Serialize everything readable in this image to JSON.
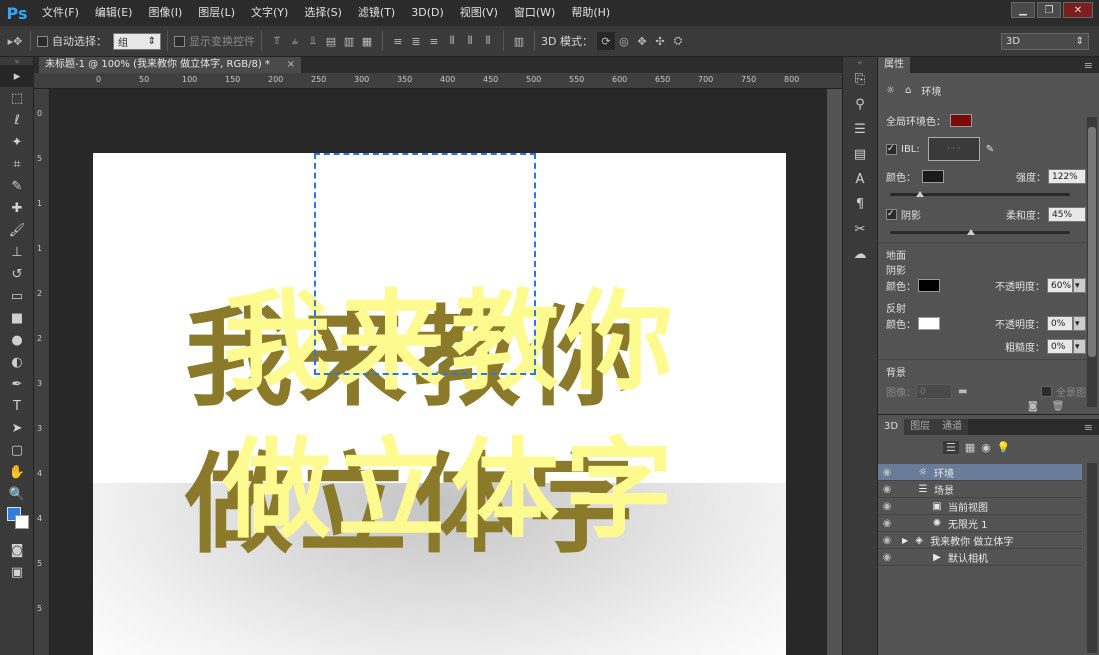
{
  "app": {
    "logo": "Ps"
  },
  "menu": [
    "文件(F)",
    "编辑(E)",
    "图像(I)",
    "图层(L)",
    "文字(Y)",
    "选择(S)",
    "滤镜(T)",
    "3D(D)",
    "视图(V)",
    "窗口(W)",
    "帮助(H)"
  ],
  "window_controls": {
    "minimize": "▁",
    "restore": "❐",
    "close": "✕"
  },
  "options": {
    "auto_select_label": "自动选择：",
    "auto_select_value": "组",
    "show_transform_label": "显示变换控件",
    "mode_3d_label": "3D 模式：",
    "workspace_value": "3D"
  },
  "document": {
    "tab_title": "未标题-1 @ 100% (我来教你 做立体字, RGB/8) *",
    "close": "×",
    "line1": "我来教你",
    "line2": "做立体字"
  },
  "ruler": {
    "top_ticks": [
      "0",
      "50",
      "100",
      "150",
      "200",
      "250",
      "300",
      "350",
      "400",
      "450",
      "500",
      "550",
      "600",
      "650",
      "700",
      "750",
      "800"
    ],
    "left_ticks": [
      "0",
      "5",
      "1",
      "1",
      "2",
      "2",
      "3",
      "3",
      "4",
      "4",
      "5",
      "5"
    ]
  },
  "properties": {
    "tab": "属性",
    "section": "环境",
    "global_ambient_label": "全局环境色：",
    "global_ambient_color": "#7a0a0a",
    "ibl_label": "IBL:",
    "color_label": "颜色：",
    "color_value": "#1a1a1a",
    "intensity_label": "强度：",
    "intensity_value": "122%",
    "shadow_label": "阴影",
    "softness_label": "柔和度：",
    "softness_value": "45%",
    "ground_label": "地面",
    "ground_shadow_label": "阴影",
    "ground_shadow_color_label": "颜色：",
    "ground_shadow_color": "#000000",
    "ground_shadow_opacity_label": "不透明度：",
    "ground_shadow_opacity": "60%",
    "reflection_label": "反射",
    "reflection_color_label": "颜色：",
    "reflection_color": "#ffffff",
    "reflection_opacity_label": "不透明度：",
    "reflection_opacity": "0%",
    "roughness_label": "粗糙度：",
    "roughness_value": "0%",
    "background_label": "背景",
    "image_label": "图像：",
    "image_value": "0",
    "panorama_label": "全景图"
  },
  "panel3d": {
    "tabs": [
      "3D",
      "图层",
      "通道"
    ],
    "layers": [
      {
        "name": "环境",
        "icon": "☼",
        "selected": true
      },
      {
        "name": "场景",
        "icon": "☰",
        "selected": false
      },
      {
        "name": "当前视图",
        "icon": "▣",
        "selected": false
      },
      {
        "name": "无限光 1",
        "icon": "✺",
        "selected": false
      },
      {
        "name": "我来教你 做立体字",
        "icon": "◈",
        "selected": false
      },
      {
        "name": "默认相机",
        "icon": "▶",
        "selected": false
      }
    ]
  }
}
